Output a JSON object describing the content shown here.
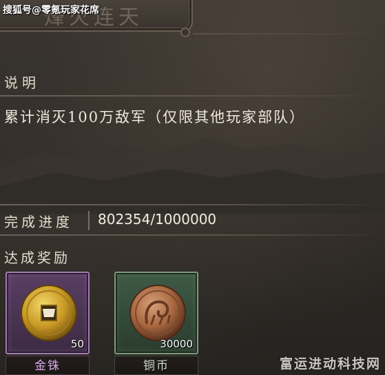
{
  "watermark": "搜狐号@零氪玩家花席",
  "watermark_bottom": "富运进动科技网",
  "title": "烽火连天",
  "description": {
    "label": "说明",
    "text": "累计消灭100万敌军（仅限其他玩家部队）"
  },
  "progress": {
    "label": "完成进度",
    "value": "802354/1000000",
    "current": 802354,
    "total": 1000000
  },
  "rewards": {
    "label": "达成奖励",
    "items": [
      {
        "name": "金铢",
        "quantity": "50",
        "rarity_color": "#a27ab0",
        "icon": "gold-coin-icon"
      },
      {
        "name": "铜币",
        "quantity": "30000",
        "rarity_color": "#7f9a78",
        "icon": "copper-coin-icon"
      }
    ]
  }
}
